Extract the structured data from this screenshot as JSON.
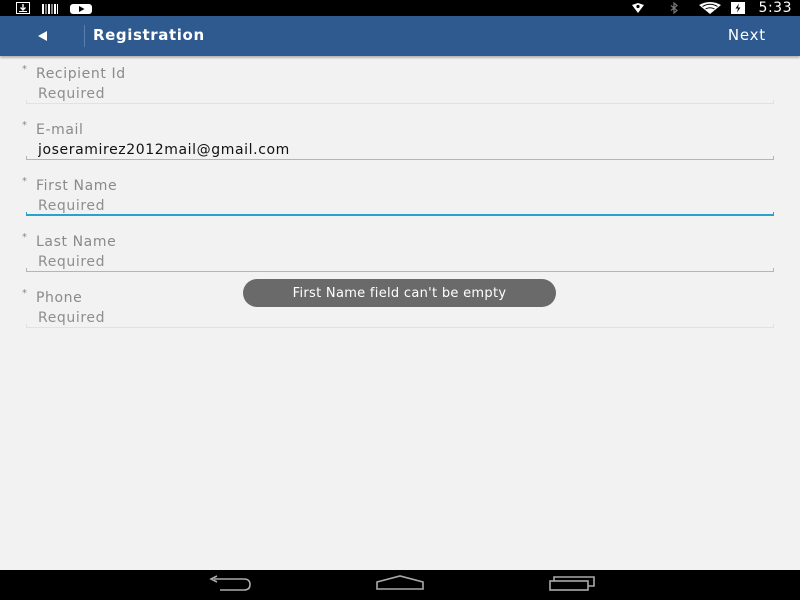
{
  "status_bar": {
    "time": "5:33",
    "icons": [
      "download-icon",
      "barcode-icon",
      "video-icon",
      "location-icon",
      "bluetooth-icon",
      "wifi-icon",
      "battery-icon"
    ]
  },
  "action_bar": {
    "title": "Registration",
    "next_label": "Next",
    "color": "#2e5a8f"
  },
  "form": {
    "required_marker": "*",
    "fields": [
      {
        "label": "Recipient Id",
        "value": "",
        "placeholder": "Required"
      },
      {
        "label": "E-mail",
        "value": "joseramirez2012mail@gmail.com",
        "placeholder": "Required"
      },
      {
        "label": "First Name",
        "value": "",
        "placeholder": "Required"
      },
      {
        "label": "Last Name",
        "value": "",
        "placeholder": "Required"
      },
      {
        "label": "Phone",
        "value": "",
        "placeholder": "Required"
      }
    ]
  },
  "toast": {
    "message": "First Name field can't be empty"
  },
  "nav_bar": {
    "buttons": [
      "back-icon",
      "home-icon",
      "recents-icon"
    ]
  }
}
